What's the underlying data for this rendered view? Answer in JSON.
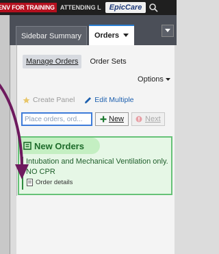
{
  "topbar": {
    "env_badge": "ENV FOR TRAINING",
    "attending": "ATTENDING L",
    "logo": "EpicCare",
    "search_icon": "search-icon"
  },
  "tabs": {
    "sidebar_summary": "Sidebar Summary",
    "orders": "Orders",
    "orders_dropdown_icon": "chevron-down-icon",
    "menu_icon": "chevron-down-icon"
  },
  "orders_panel": {
    "subtabs": [
      "Manage Orders",
      "Order Sets"
    ],
    "options_label": "Options",
    "create_panel_label": "Create Panel",
    "edit_multiple_label": "Edit Multiple",
    "order_input_placeholder": "Place orders, ord...",
    "new_button_label": "New",
    "next_button_label": "Next"
  },
  "new_orders": {
    "header": "New Orders",
    "order_text": "Intubation and Mechanical Ventilation only. NO CPR",
    "details_label": "Order details"
  },
  "colors": {
    "accent_blue": "#3d7bd9",
    "env_red": "#b4101e",
    "new_orders_green": "#66c277",
    "annotation_arrow": "#6e1a5e"
  }
}
